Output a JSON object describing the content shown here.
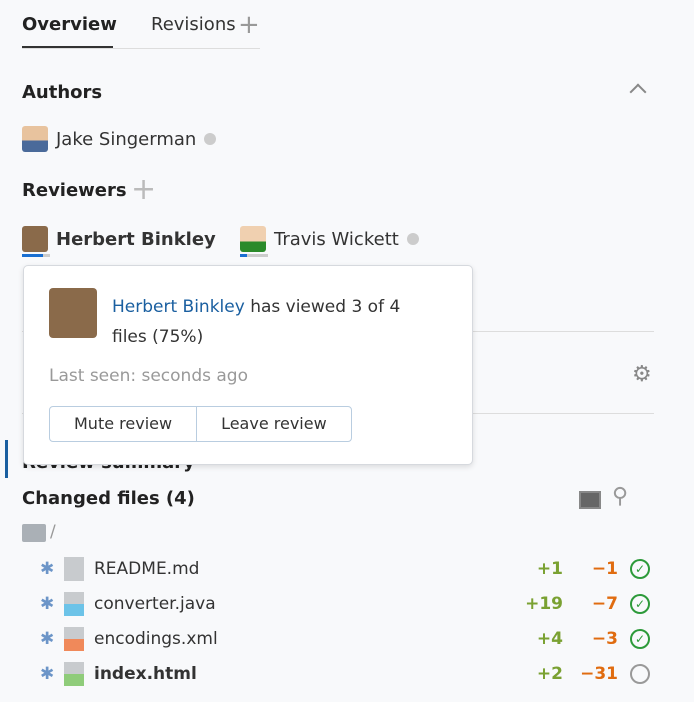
{
  "tabs": [
    {
      "label": "Overview"
    },
    {
      "label": "Revisions"
    }
  ],
  "authors": {
    "title": "Authors",
    "items": [
      {
        "name": "Jake Singerman"
      }
    ]
  },
  "reviewers": {
    "title": "Reviewers",
    "items": [
      {
        "name": "Herbert Binkley",
        "progress": 0.75
      },
      {
        "name": "Travis Wickett",
        "progress": 0.1
      }
    ]
  },
  "popover": {
    "name": "Herbert Binkley",
    "text_line1": " has viewed 3 of 4",
    "text_line2": "files (75%)",
    "last_seen": "Last seen: seconds ago",
    "mute": "Mute review",
    "leave": "Leave review"
  },
  "review_summary": "Review summary",
  "changed_files": {
    "title": "Changed files (4)",
    "folder": "/",
    "files": [
      {
        "name": "README.md",
        "type": "md",
        "added": "+1",
        "removed": "−1",
        "viewed": true
      },
      {
        "name": "converter.java",
        "type": "java",
        "added": "+19",
        "removed": "−7",
        "viewed": true
      },
      {
        "name": "encodings.xml",
        "type": "xml",
        "added": "+4",
        "removed": "−3",
        "viewed": true
      },
      {
        "name": "index.html",
        "type": "html",
        "added": "+2",
        "removed": "−31",
        "viewed": false
      }
    ]
  },
  "colors": {
    "accent": "#1a6fd1",
    "added": "#7aa132",
    "removed": "#e06c10",
    "viewed": "#2d9a3a"
  }
}
